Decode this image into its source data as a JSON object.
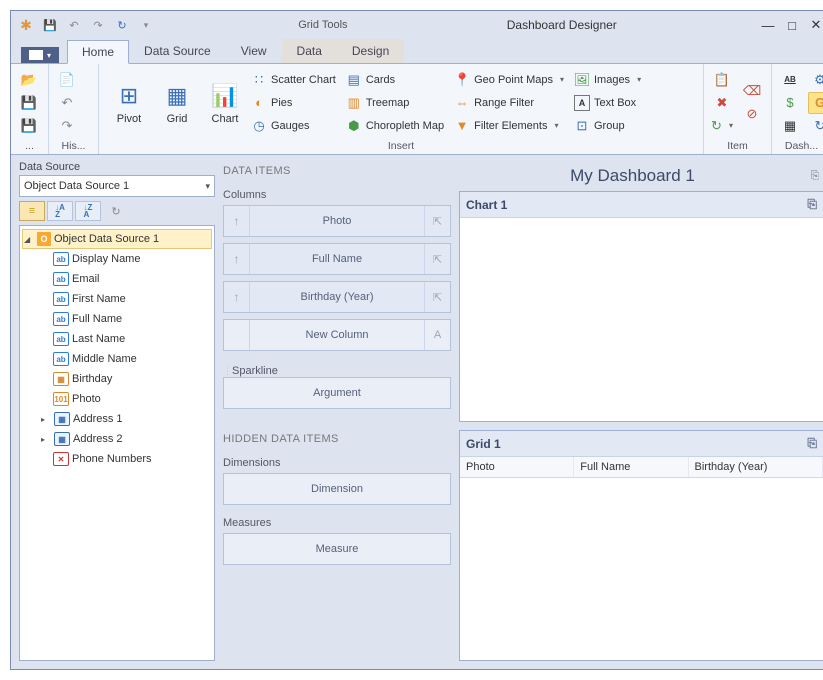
{
  "titlebar": {
    "context_tab": "Grid Tools",
    "window_title": "Dashboard Designer"
  },
  "ribbon": {
    "tabs": {
      "home": "Home",
      "data_source": "Data Source",
      "view": "View",
      "data": "Data",
      "design": "Design"
    },
    "groups": {
      "history": "His...",
      "pivot": "Pivot",
      "grid": "Grid",
      "chart": "Chart",
      "scatter": "Scatter Chart",
      "pies": "Pies",
      "gauges": "Gauges",
      "cards": "Cards",
      "treemap": "Treemap",
      "choropleth": "Choropleth Map",
      "geo": "Geo Point Maps",
      "range": "Range Filter",
      "filter": "Filter Elements",
      "images": "Images",
      "textbox": "Text Box",
      "group": "Group",
      "insert_label": "Insert",
      "item_label": "Item",
      "dash_label": "Dash..."
    }
  },
  "ds": {
    "label": "Data Source",
    "selected": "Object Data Source 1",
    "tree_root": "Object Data Source 1",
    "fields": {
      "display_name": "Display Name",
      "email": "Email",
      "first_name": "First Name",
      "full_name": "Full Name",
      "last_name": "Last Name",
      "middle_name": "Middle Name",
      "birthday": "Birthday",
      "photo": "Photo",
      "address1": "Address 1",
      "address2": "Address 2",
      "phone": "Phone Numbers"
    }
  },
  "di": {
    "header": "DATA ITEMS",
    "columns_label": "Columns",
    "columns": {
      "photo": "Photo",
      "full_name": "Full Name",
      "birthday": "Birthday (Year)",
      "new": "New Column"
    },
    "sparkline_label": "Sparkline",
    "sparkline_item": "Argument",
    "hidden_header": "HIDDEN DATA ITEMS",
    "dim_label": "Dimensions",
    "dim_item": "Dimension",
    "meas_label": "Measures",
    "meas_item": "Measure"
  },
  "canvas": {
    "dash_title": "My Dashboard 1",
    "chart_title": "Chart 1",
    "grid_title": "Grid 1",
    "grid_cols": {
      "c1": "Photo",
      "c2": "Full Name",
      "c3": "Birthday (Year)"
    }
  }
}
